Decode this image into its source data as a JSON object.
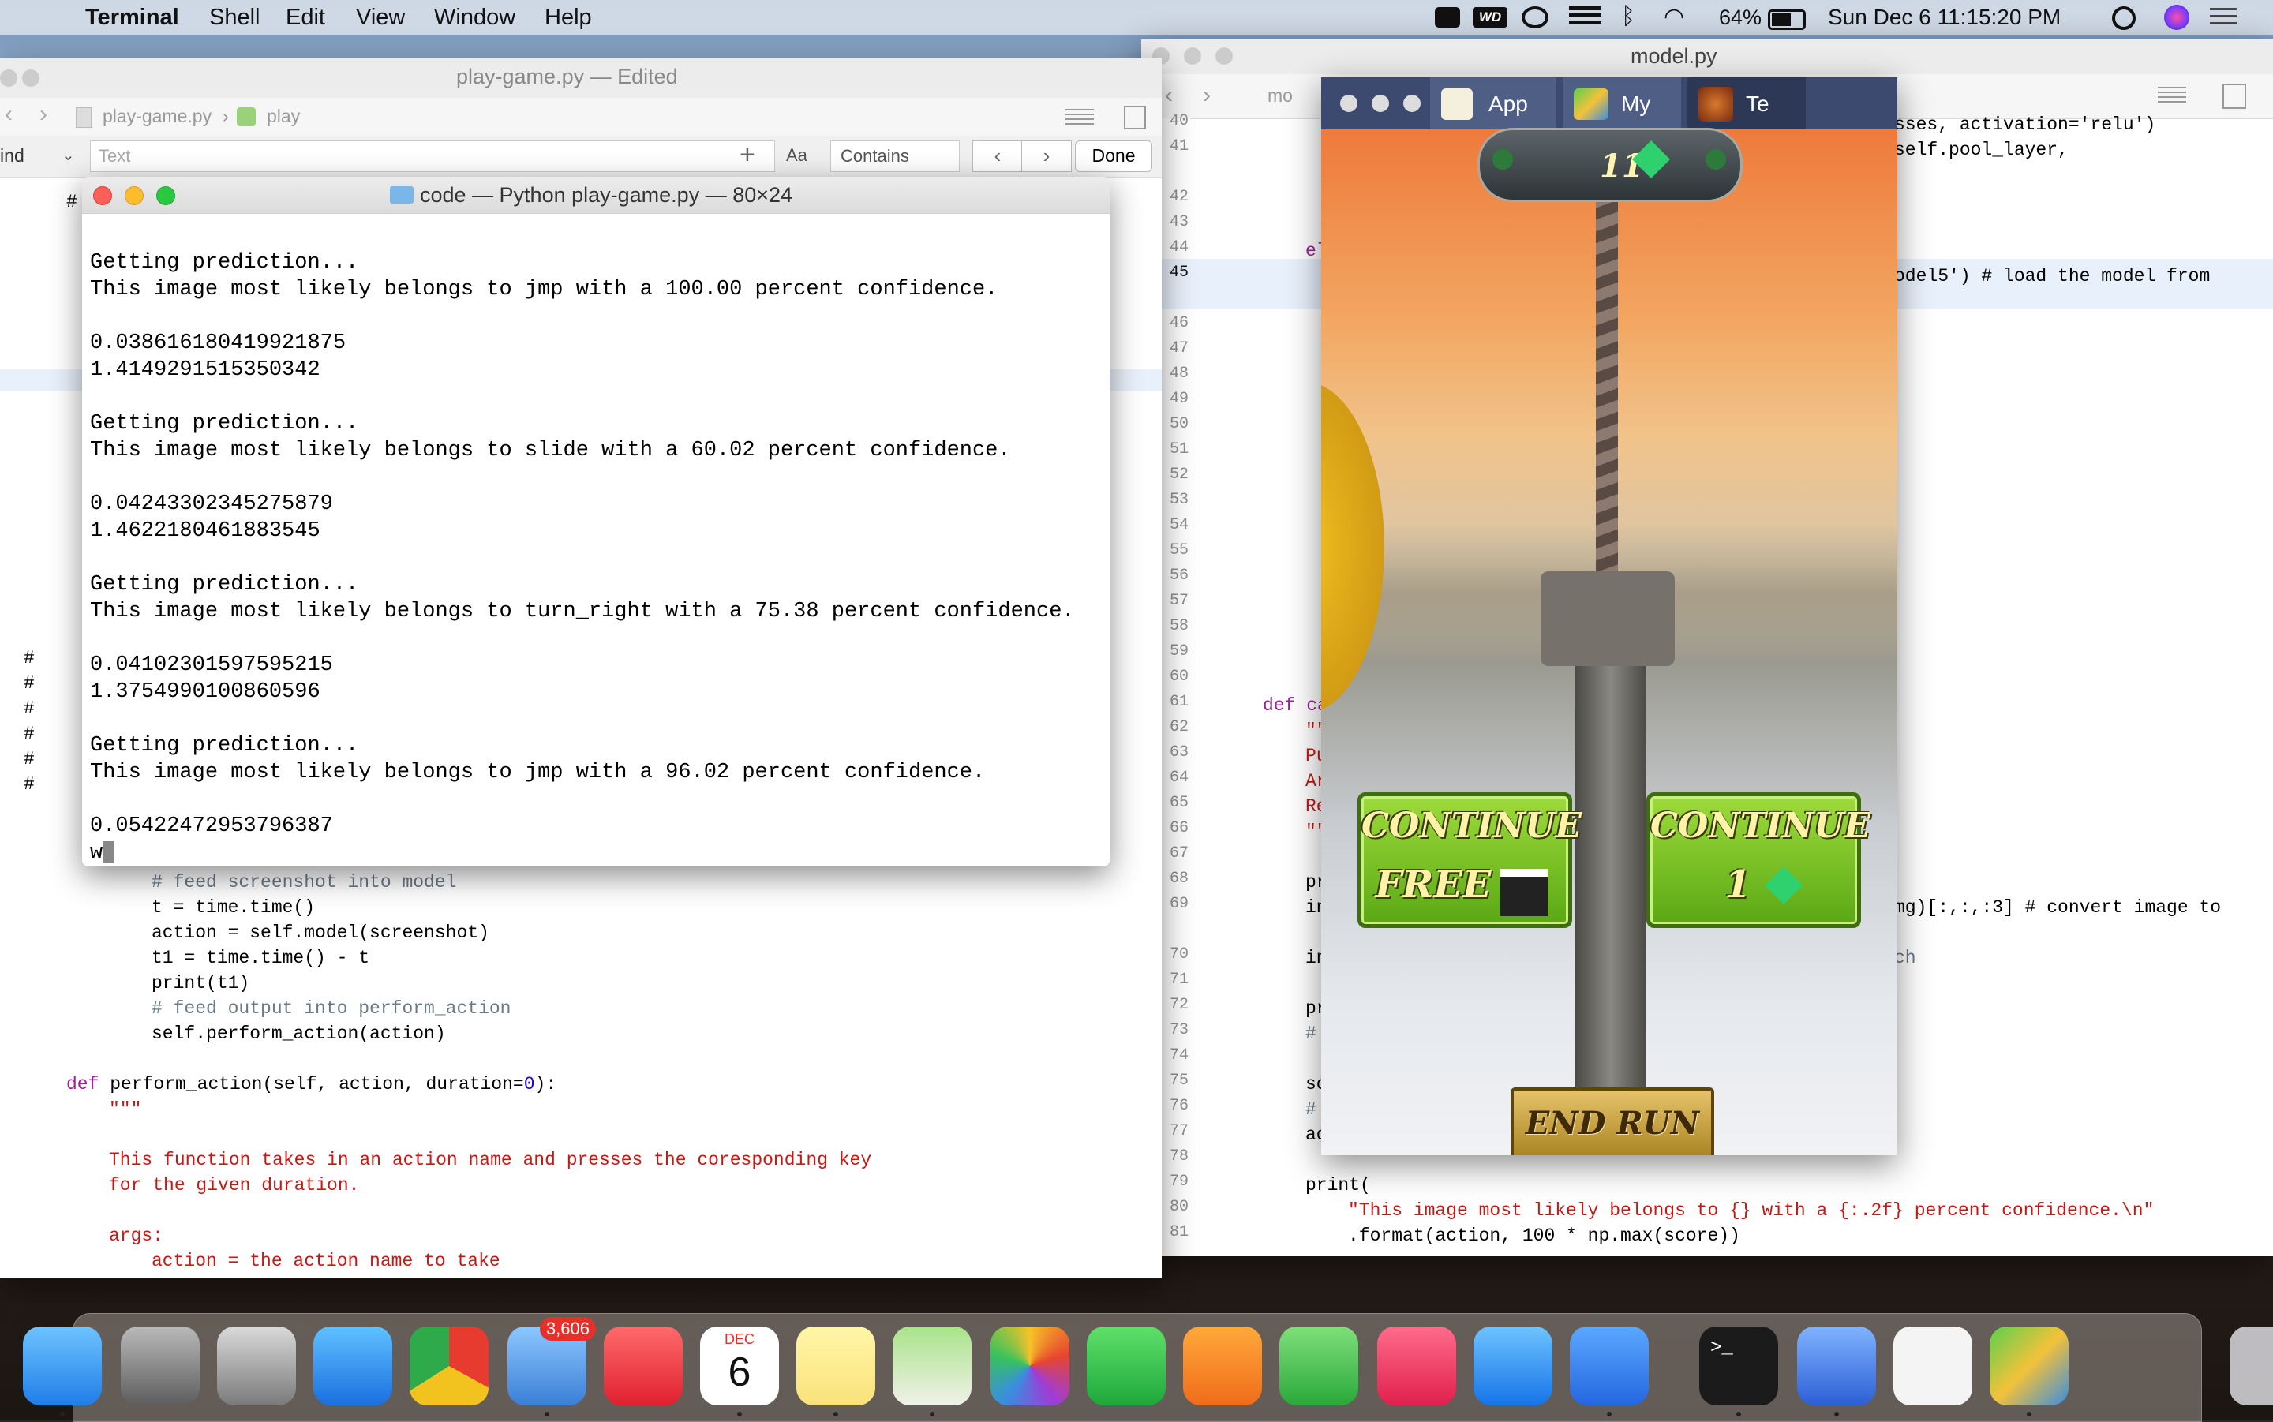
{
  "menubar": {
    "app": "Terminal",
    "items": [
      "Shell",
      "Edit",
      "View",
      "Window",
      "Help"
    ],
    "battery": "64%",
    "clock": "Sun Dec 6  11:15:20 PM"
  },
  "left_editor": {
    "title": "play-game.py — Edited",
    "breadcrumb_file": "play-game.py",
    "breadcrumb_symbol": "play",
    "find_mode": "Find",
    "find_placeholder": "Text",
    "find_case": "Aa",
    "find_match": "Contains",
    "find_done": "Done",
    "comment_marks": [
      "#",
      "#",
      "#",
      "#",
      "#",
      "#",
      "#"
    ],
    "lines": [
      {
        "i": 2,
        "text": "# feed screenshot into model",
        "cls": "cm"
      },
      {
        "i": 2,
        "text": "t = time.time()",
        "cls": ""
      },
      {
        "i": 2,
        "text": "action = self.model(screenshot)",
        "cls": ""
      },
      {
        "i": 2,
        "text": "t1 = time.time() - t",
        "cls": ""
      },
      {
        "i": 2,
        "text": "print(t1)",
        "cls": ""
      },
      {
        "i": 2,
        "text": "# feed output into perform_action",
        "cls": "cm"
      },
      {
        "i": 2,
        "text": "self.perform_action(action)",
        "cls": ""
      },
      {
        "i": 0,
        "text": "",
        "cls": ""
      },
      {
        "i": 0,
        "text": "def perform_action(self, action, duration=0):",
        "cls": "def"
      },
      {
        "i": 1,
        "text": "\"\"\"",
        "cls": "st"
      },
      {
        "i": 0,
        "text": "",
        "cls": ""
      },
      {
        "i": 1,
        "text": "This function takes in an action name and presses the coresponding key",
        "cls": "st"
      },
      {
        "i": 1,
        "text": "for the given duration.",
        "cls": "st"
      },
      {
        "i": 0,
        "text": "",
        "cls": ""
      },
      {
        "i": 1,
        "text": "args:",
        "cls": "st"
      },
      {
        "i": 2,
        "text": "action = the action name to take",
        "cls": "st"
      }
    ]
  },
  "terminal": {
    "title": "code — Python play-game.py — 80×24",
    "lines": [
      "",
      "Getting prediction...",
      "This image most likely belongs to jmp with a 100.00 percent confidence.",
      "",
      "0.038616180419921875",
      "1.4149291515350342",
      "",
      "Getting prediction...",
      "This image most likely belongs to slide with a 60.02 percent confidence.",
      "",
      "0.04243302345275879",
      "1.4622180461883545",
      "",
      "Getting prediction...",
      "This image most likely belongs to turn_right with a 75.38 percent confidence.",
      "",
      "0.04102301597595215",
      "1.3754990100860596",
      "",
      "Getting prediction...",
      "This image most likely belongs to jmp with a 96.02 percent confidence.",
      "",
      "0.05422472953796387",
      "w"
    ]
  },
  "right_editor": {
    "title": "model.py",
    "breadcrumb": "mo",
    "line_numbers": [
      "40",
      "41",
      "42",
      "43",
      "44",
      "45",
      "46",
      "47",
      "48",
      "49",
      "50",
      "51",
      "52",
      "53",
      "54",
      "55",
      "56",
      "57",
      "58",
      "59",
      "60",
      "61",
      "62",
      "63",
      "64",
      "65",
      "66",
      "67",
      "68",
      "69",
      "70",
      "71",
      "72",
      "73",
      "74",
      "75",
      "76",
      "77",
      "78",
      "79",
      "80",
      "81"
    ],
    "code_40": "sses, activation='relu')",
    "code_41": "self.pool_layer,",
    "code_44": "el",
    "code_45": "odel5') # load the model from",
    "code_61": "def ca",
    "code_62": "\"\"",
    "code_63": "Pu",
    "code_64": "Ar",
    "code_65": "Re",
    "code_66": "\"\"",
    "code_68": "pr",
    "code_69a": "in",
    "code_69b": "mg)[:,:,:3] # convert image to",
    "code_70a": "in",
    "code_70b": "ch",
    "code_72": "pr",
    "code_73": "#",
    "code_75": "sc",
    "code_76": "#",
    "code_77": "ac",
    "code_79": "print(",
    "code_80": "\"This image most likely belongs to {} with a {:.2f} percent confidence.\\n\"",
    "code_81": ".format(action, 100 * np.max(score))"
  },
  "game": {
    "tabs": [
      "App",
      "My",
      "Te"
    ],
    "gem_count": "11",
    "continue_free_1": "CONTINUE",
    "continue_free_2": "FREE",
    "continue_paid_1": "CONTINUE",
    "continue_paid_2": "1",
    "end_run": "END RUN"
  },
  "dock": {
    "mail_badge": "3,606",
    "calendar_month": "DEC",
    "calendar_day": "6",
    "apps": [
      "finder",
      "system-preferences",
      "launchpad",
      "safari",
      "chrome",
      "mail",
      "news",
      "calendar",
      "notes",
      "maps",
      "photos",
      "facetime",
      "pages",
      "numbers",
      "music",
      "app-store",
      "zoom",
      "terminal",
      "xcode",
      "textedit",
      "bluestacks",
      "rocket",
      "trash"
    ]
  }
}
